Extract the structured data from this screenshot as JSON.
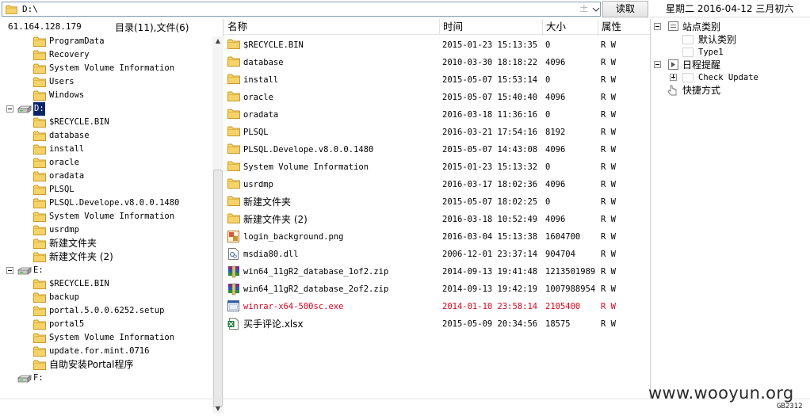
{
  "toolbar": {
    "path_value": "D:\\",
    "read_button_label": "读取"
  },
  "date_display": "星期二 2016-04-12 三月初六",
  "left_header": {
    "ip_address": "61.164.128.179",
    "dir_file_count": "目录(11),文件(6)"
  },
  "tree": {
    "c_children": [
      "ProgramData",
      "Recovery",
      "System Volume Information",
      "Users",
      "Windows"
    ],
    "drive_d": "D:",
    "d_children": [
      "$RECYCLE.BIN",
      "database",
      "install",
      "oracle",
      "oradata",
      "PLSQL",
      "PLSQL.Develope.v8.0.0.1480",
      "System Volume Information",
      "usrdmp",
      "新建文件夹",
      "新建文件夹 (2)"
    ],
    "drive_e": "E:",
    "e_children": [
      "$RECYCLE.BIN",
      "backup",
      "portal.5.0.0.6252.setup",
      "portal5",
      "System Volume Information",
      "update.for.mint.0716",
      "自助安装Portal程序"
    ],
    "drive_f": "F:"
  },
  "file_list": {
    "columns": {
      "name": "名称",
      "time": "时间",
      "size": "大小",
      "attr": "属性"
    },
    "rows": [
      {
        "name": "$RECYCLE.BIN",
        "time": "2015-01-23 15:13:35",
        "size": "0",
        "attr": "R W",
        "icon": "folder-icon"
      },
      {
        "name": "database",
        "time": "2010-03-30 18:18:22",
        "size": "4096",
        "attr": "R W",
        "icon": "folder-icon"
      },
      {
        "name": "install",
        "time": "2015-05-07 15:53:14",
        "size": "0",
        "attr": "R W",
        "icon": "folder-icon"
      },
      {
        "name": "oracle",
        "time": "2015-05-07 15:40:40",
        "size": "4096",
        "attr": "R W",
        "icon": "folder-icon"
      },
      {
        "name": "oradata",
        "time": "2016-03-18 11:36:16",
        "size": "0",
        "attr": "R W",
        "icon": "folder-icon"
      },
      {
        "name": "PLSQL",
        "time": "2016-03-21 17:54:16",
        "size": "8192",
        "attr": "R W",
        "icon": "folder-icon"
      },
      {
        "name": "PLSQL.Develope.v8.0.0.1480",
        "time": "2015-05-07 14:43:08",
        "size": "4096",
        "attr": "R W",
        "icon": "folder-icon"
      },
      {
        "name": "System Volume Information",
        "time": "2015-01-23 15:13:32",
        "size": "0",
        "attr": "R W",
        "icon": "folder-icon"
      },
      {
        "name": "usrdmp",
        "time": "2016-03-17 18:02:36",
        "size": "4096",
        "attr": "R W",
        "icon": "folder-icon"
      },
      {
        "name": "新建文件夹",
        "time": "2015-05-07 18:02:25",
        "size": "0",
        "attr": "R W",
        "icon": "folder-icon"
      },
      {
        "name": "新建文件夹 (2)",
        "time": "2016-03-18 10:52:49",
        "size": "4096",
        "attr": "R W",
        "icon": "folder-icon"
      },
      {
        "name": "login_background.png",
        "time": "2016-03-04 15:13:38",
        "size": "1604700",
        "attr": "R W",
        "icon": "image-file-icon"
      },
      {
        "name": "msdia80.dll",
        "time": "2006-12-01 23:37:14",
        "size": "904704",
        "attr": "R W",
        "icon": "dll-file-icon"
      },
      {
        "name": "win64_11gR2_database_1of2.zip",
        "time": "2014-09-13 19:41:48",
        "size": "1213501989",
        "attr": "R W",
        "icon": "archive-file-icon"
      },
      {
        "name": "win64_11gR2_database_2of2.zip",
        "time": "2014-09-13 19:42:19",
        "size": "1007988954",
        "attr": "R W",
        "icon": "archive-file-icon"
      },
      {
        "name": "winrar-x64-500sc.exe",
        "time": "2014-01-10 23:58:14",
        "size": "2105400",
        "attr": "R W",
        "icon": "exe-file-icon",
        "highlight": "#e0001b"
      },
      {
        "name": "买手评论.xlsx",
        "time": "2015-05-09 20:34:56",
        "size": "18575",
        "attr": "R W",
        "icon": "excel-file-icon"
      }
    ]
  },
  "right_panel": {
    "site_category": "站点类别",
    "default_category": "默认类别",
    "type1": "Type1",
    "schedule": "日程提醒",
    "check_update": "Check Update",
    "shortcuts": "快捷方式"
  },
  "watermark": "www.wooyun.org",
  "encoding": "GB2312"
}
